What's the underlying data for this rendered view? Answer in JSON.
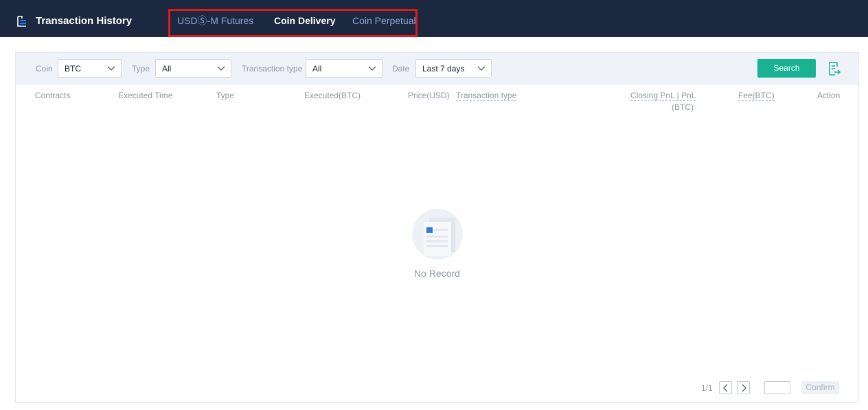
{
  "header": {
    "title": "Transaction History",
    "title_icon": "document-list-icon",
    "tabs": [
      {
        "label": "USDⓈ-M Futures",
        "active": false
      },
      {
        "label": "Coin Delivery",
        "active": true
      },
      {
        "label": "Coin Perpetual",
        "active": false
      }
    ]
  },
  "filters": {
    "coin": {
      "label": "Coin",
      "value": "BTC"
    },
    "type": {
      "label": "Type",
      "value": "All"
    },
    "transaction_type": {
      "label": "Transaction type",
      "value": "All"
    },
    "date": {
      "label": "Date",
      "value": "Last 7 days"
    },
    "search_label": "Search",
    "export_icon": "export-icon"
  },
  "table": {
    "columns": {
      "contracts": "Contracts",
      "executed_time": "Executed Time",
      "type": "Type",
      "executed": "Executed(BTC)",
      "price": "Price(USD)",
      "transaction_type": "Transaction type",
      "closing_pnl": "Closing PnL | PnL",
      "closing_pnl_unit": "(BTC)",
      "fee": "Fee(BTC)",
      "action": "Action"
    },
    "rows": [],
    "empty_text": "No Record"
  },
  "pagination": {
    "page_text": "1/1",
    "page_input_value": "",
    "confirm_label": "Confirm"
  },
  "colors": {
    "header_bg": "#1c2840",
    "accent": "#19b393",
    "tab_inactive": "#8ea5d4",
    "highlight_box": "#e01a1a"
  }
}
